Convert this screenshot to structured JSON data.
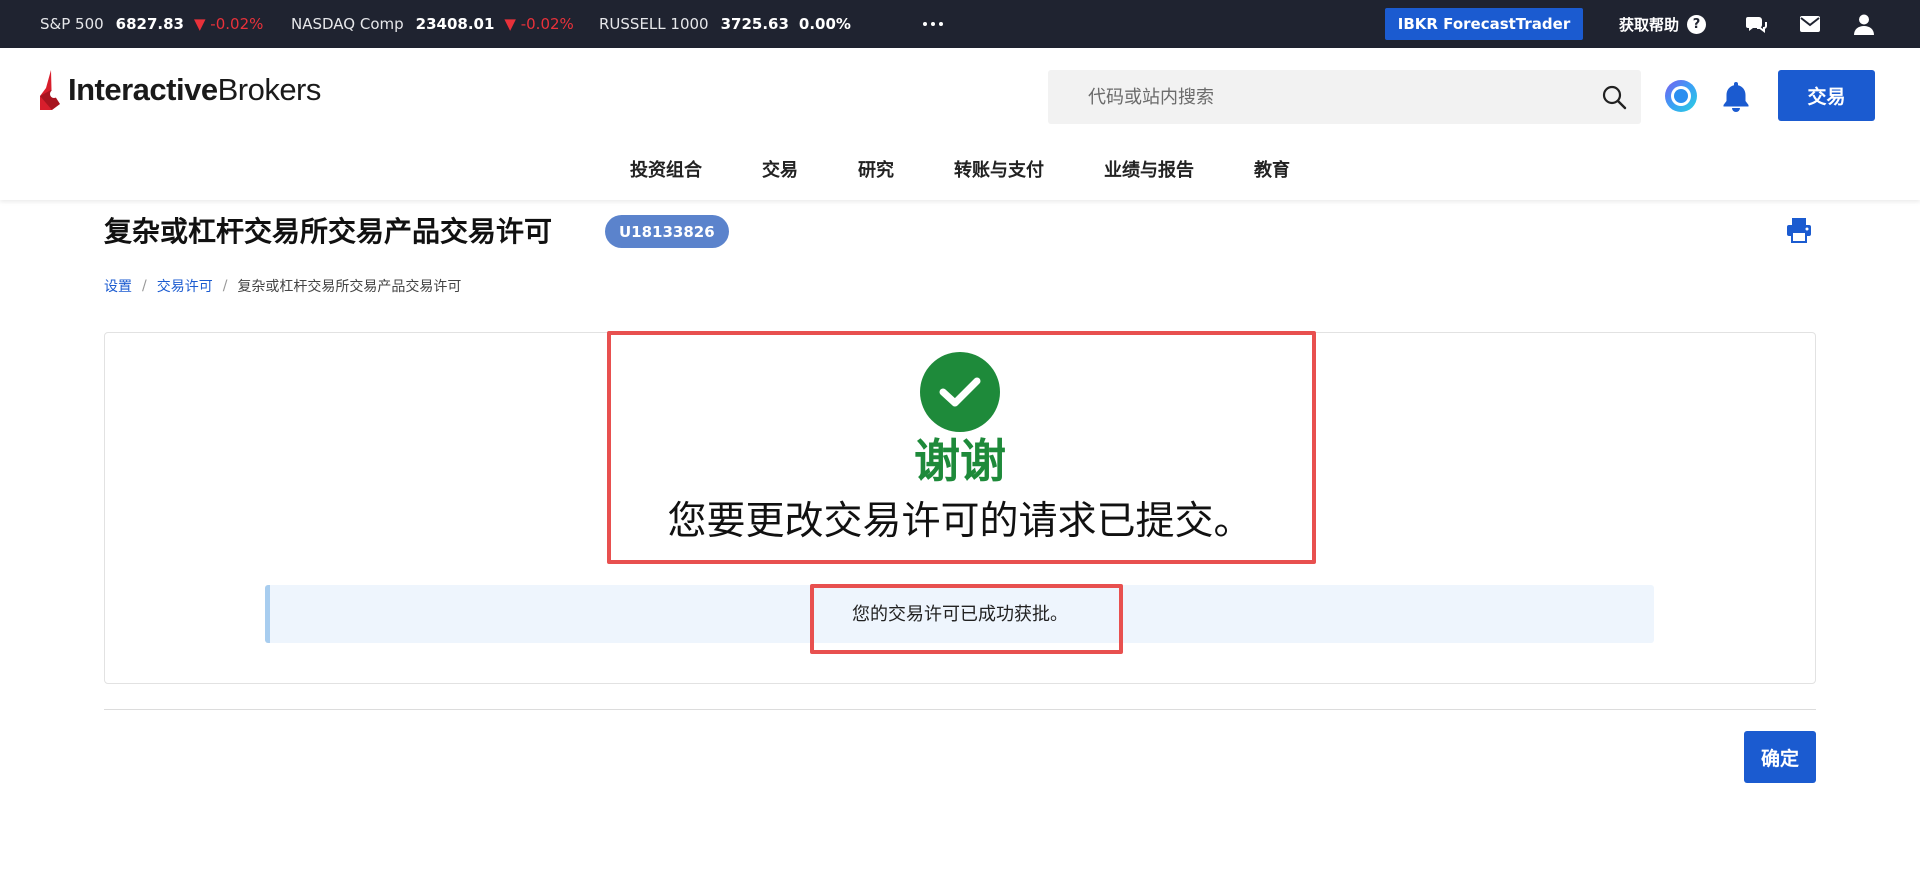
{
  "ticker": [
    {
      "name": "S&P 500",
      "value": "6827.83",
      "change": "▼ -0.02%",
      "direction": "down"
    },
    {
      "name": "NASDAQ Comp",
      "value": "23408.01",
      "change": "▼ -0.02%",
      "direction": "down"
    },
    {
      "name": "RUSSELL 1000",
      "value": "3725.63",
      "change": "0.00%",
      "direction": "flat"
    }
  ],
  "topbar": {
    "forecast_trader": "IBKR ForecastTrader",
    "help_label": "获取帮助",
    "help_glyph": "?"
  },
  "header": {
    "logo_bold": "Interactive",
    "logo_regular": "Brokers",
    "search_placeholder": "代码或站内搜索",
    "trade_button": "交易"
  },
  "nav": [
    "投资组合",
    "交易",
    "研究",
    "转账与支付",
    "业绩与报告",
    "教育"
  ],
  "page": {
    "title": "复杂或杠杆交易所交易产品交易许可",
    "account_id": "U18133826",
    "breadcrumb": [
      "设置",
      "交易许可",
      "复杂或杠杆交易所交易产品交易许可"
    ]
  },
  "result": {
    "thanks": "谢谢",
    "submitted": "您要更改交易许可的请求已提交。",
    "approved": "您的交易许可已成功获批。"
  },
  "footer": {
    "confirm": "确定"
  },
  "colors": {
    "accent": "#1b5bd0",
    "success": "#1e8a3a",
    "down": "#e8313a",
    "highlight": "#e8504f",
    "topbar": "#1f2330"
  },
  "icons": [
    "more-icon",
    "help-icon",
    "chat-icon",
    "mail-icon",
    "user-icon",
    "search-icon",
    "ai-assistant-icon",
    "bell-icon",
    "print-icon",
    "check-icon"
  ]
}
